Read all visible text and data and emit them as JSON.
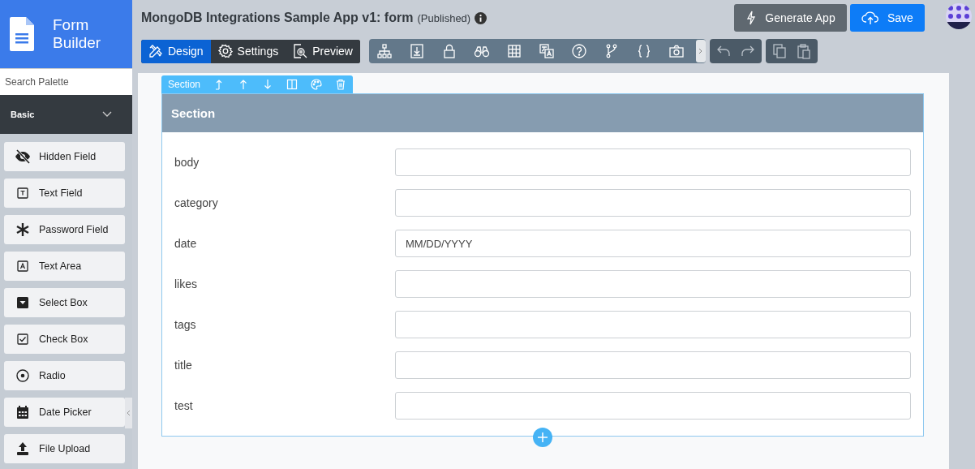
{
  "logo": {
    "line1": "Form",
    "line2": "Builder"
  },
  "palette": {
    "search_placeholder": "Search Palette",
    "group": {
      "label": "Basic",
      "expanded": true
    },
    "items": [
      {
        "label": "Hidden Field",
        "kind": "hidden"
      },
      {
        "label": "Text Field",
        "kind": "text"
      },
      {
        "label": "Password Field",
        "kind": "password"
      },
      {
        "label": "Text Area",
        "kind": "textarea"
      },
      {
        "label": "Select Box",
        "kind": "select"
      },
      {
        "label": "Check Box",
        "kind": "checkbox"
      },
      {
        "label": "Radio",
        "kind": "radio"
      },
      {
        "label": "Date Picker",
        "kind": "date"
      },
      {
        "label": "File Upload",
        "kind": "upload"
      }
    ]
  },
  "header": {
    "title": "MongoDB Integrations Sample App v1: form",
    "status": "(Published)"
  },
  "tabs": [
    {
      "label": "Design",
      "selected": true,
      "kind": "design"
    },
    {
      "label": "Settings",
      "selected": false,
      "kind": "settings"
    },
    {
      "label": "Preview",
      "selected": false,
      "kind": "preview"
    }
  ],
  "actions": [
    {
      "label": "Generate App",
      "kind": "generate"
    },
    {
      "label": "Save",
      "kind": "save"
    }
  ],
  "section": {
    "toolbar_label": "Section",
    "title": "Section",
    "fields": [
      {
        "label": "body"
      },
      {
        "label": "category"
      },
      {
        "label": "date",
        "placeholder": "MM/DD/YYYY"
      },
      {
        "label": "likes"
      },
      {
        "label": "tags"
      },
      {
        "label": "title"
      },
      {
        "label": "test"
      }
    ]
  }
}
